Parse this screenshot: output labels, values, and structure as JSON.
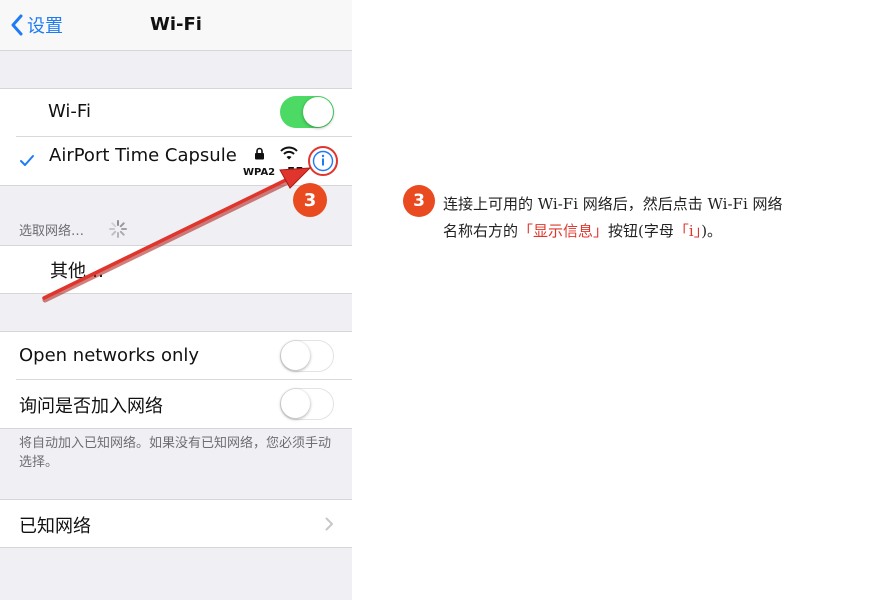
{
  "navbar": {
    "back_label": "设置",
    "title": "Wi-Fi"
  },
  "wifi_group": {
    "wifi_label": "Wi-Fi",
    "wifi_on": true,
    "connected_network": "AirPort Time Capsule",
    "security_label": "WPA2",
    "signal_label": "-55"
  },
  "choose_network": {
    "header": "选取网络…",
    "other_label": "其他…"
  },
  "options": {
    "open_networks_label": "Open networks only",
    "open_networks_on": false,
    "ask_to_join_label": "询问是否加入网络",
    "ask_to_join_on": false,
    "note": "将自动加入已知网络。如果没有已知网络，您必须手动选择。"
  },
  "known_networks": {
    "label": "已知网络"
  },
  "annotation": {
    "step_number": "3",
    "line1": "连接上可用的 Wi-Fi 网络后，然后点击 Wi-Fi 网络",
    "line2_prefix": "名称右方的",
    "line2_highlight1": "「显示信息」",
    "line2_mid": "按钮(字母",
    "line2_highlight2": "「i」",
    "line2_suffix": ")。"
  },
  "colors": {
    "ios_blue": "#1f7bf5",
    "switch_green": "#4cd964",
    "annotation_red": "#e0352c",
    "badge_orange": "#ea4a1f"
  }
}
